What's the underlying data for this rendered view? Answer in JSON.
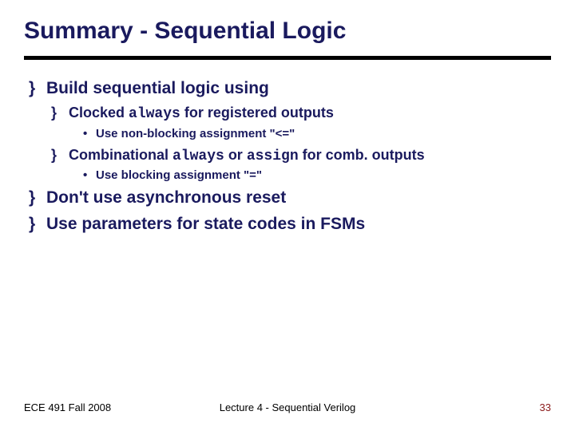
{
  "title": "Summary - Sequential Logic",
  "bullets": {
    "b1": "Build sequential logic using",
    "b1a_pre": "Clocked ",
    "b1a_code": "always",
    "b1a_post": " for registered outputs",
    "b1a1": "Use non-blocking assignment \"<=\"",
    "b1b_pre": "Combinational ",
    "b1b_code1": "always",
    "b1b_mid": " or ",
    "b1b_code2": "assign",
    "b1b_post": " for comb. outputs",
    "b1b1": "Use blocking assignment \"=\"",
    "b2": "Don't use asynchronous reset",
    "b3": "Use parameters for state codes in FSMs"
  },
  "footer": {
    "left": "ECE 491 Fall 2008",
    "center": "Lecture 4 - Sequential Verilog",
    "right": "33"
  }
}
